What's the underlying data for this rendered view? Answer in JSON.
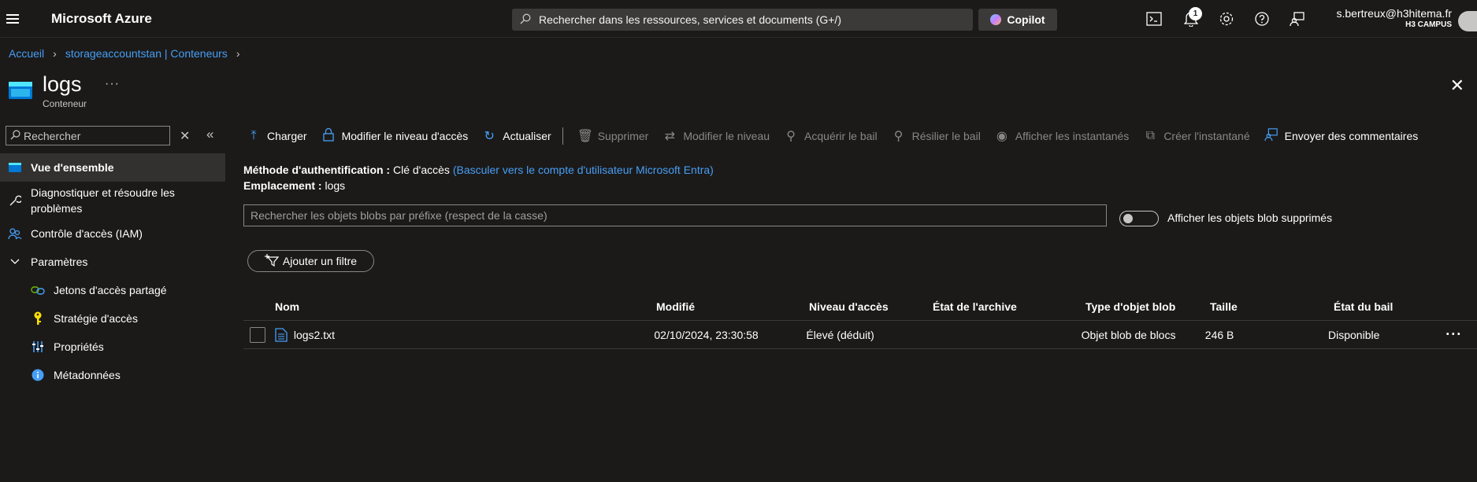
{
  "topbar": {
    "brand": "Microsoft Azure",
    "search_placeholder": "Rechercher dans les ressources, services et documents (G+/)",
    "copilot_label": "Copilot",
    "notification_count": "1",
    "account_email": "s.bertreux@h3hitema.fr",
    "account_tenant": "H3 CAMPUS"
  },
  "breadcrumb": {
    "home": "Accueil",
    "parent": "storageaccountstan | Conteneurs"
  },
  "header": {
    "title": "logs",
    "subtitle": "Conteneur",
    "more": "···"
  },
  "sidebar": {
    "search_placeholder": "Rechercher",
    "items": [
      {
        "label": "Vue d'ensemble"
      },
      {
        "label": "Diagnostiquer et résoudre les problèmes"
      },
      {
        "label": "Contrôle d'accès (IAM)"
      },
      {
        "label": "Paramètres"
      },
      {
        "label": "Jetons d'accès partagé"
      },
      {
        "label": "Stratégie d'accès"
      },
      {
        "label": "Propriétés"
      },
      {
        "label": "Métadonnées"
      }
    ]
  },
  "toolbar": {
    "upload": "Charger",
    "change_access": "Modifier le niveau d'accès",
    "refresh": "Actualiser",
    "delete": "Supprimer",
    "change_tier": "Modifier le niveau",
    "acquire_lease": "Acquérir le bail",
    "break_lease": "Résilier le bail",
    "view_snapshots": "Afficher les instantanés",
    "create_snapshot": "Créer l'instantané",
    "feedback": "Envoyer des commentaires"
  },
  "info": {
    "auth_label": "Méthode d'authentification :",
    "auth_value": "Clé d'accès",
    "auth_link": "(Basculer vers le compte d'utilisateur Microsoft Entra)",
    "location_label": "Emplacement :",
    "location_value": "logs"
  },
  "blob_search_placeholder": "Rechercher les objets blobs par préfixe (respect de la casse)",
  "show_deleted_label": "Afficher les objets blob supprimés",
  "add_filter_label": "Ajouter un filtre",
  "table": {
    "columns": [
      "Nom",
      "Modifié",
      "Niveau d'accès",
      "État de l'archive",
      "Type d'objet blob",
      "Taille",
      "État du bail"
    ],
    "rows": [
      {
        "name": "logs2.txt",
        "modified": "02/10/2024, 23:30:58",
        "tier": "Élevé (déduit)",
        "archive": "",
        "type": "Objet blob de blocs",
        "size": "246 B",
        "lease": "Disponible"
      }
    ]
  },
  "colors": {
    "background": "#1b1a19",
    "link": "#479ef5",
    "active_nav": "#323130",
    "disabled": "#8a8886"
  }
}
